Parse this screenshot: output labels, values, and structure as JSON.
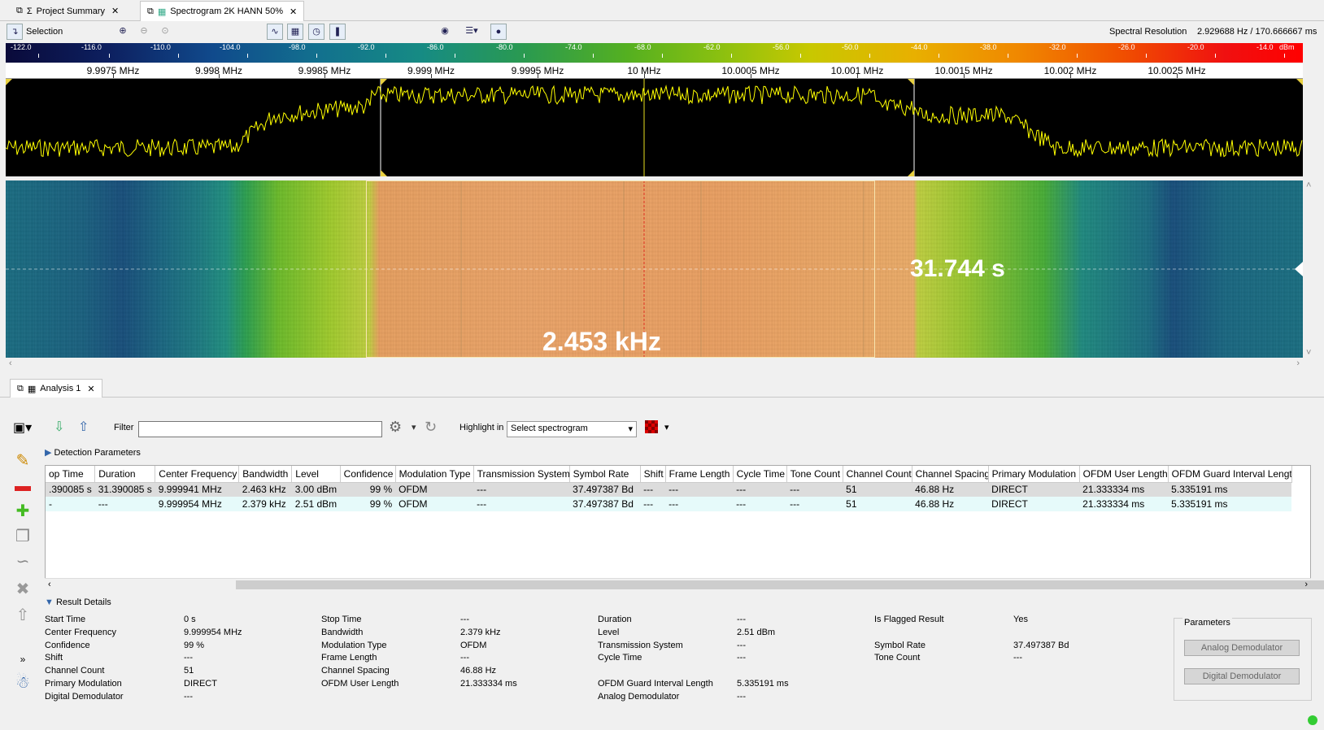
{
  "tabs": [
    {
      "label": "Project Summary",
      "icon": "sigma-icon"
    },
    {
      "label": "Spectrogram 2K HANN 50%",
      "icon": "spectrogram-icon"
    }
  ],
  "toolbar": {
    "selection_label": "Selection",
    "spectral_resolution_label": "Spectral Resolution",
    "spectral_resolution_value": "2.929688 Hz / 170.666667 ms"
  },
  "colorbar": {
    "labels": [
      "-122.0",
      "-116.0",
      "-110.0",
      "-104.0",
      "-98.0",
      "-92.0",
      "-86.0",
      "-80.0",
      "-74.0",
      "-68.0",
      "-62.0",
      "-56.0",
      "-50.0",
      "-44.0",
      "-38.0",
      "-32.0",
      "-26.0",
      "-20.0",
      "-14.0"
    ],
    "unit": "dBm"
  },
  "freq_axis": {
    "labels": [
      "9.9975 MHz",
      "9.998 MHz",
      "9.9985 MHz",
      "9.999 MHz",
      "9.9995 MHz",
      "10 MHz",
      "10.0005 MHz",
      "10.001 MHz",
      "10.0015 MHz",
      "10.002 MHz",
      "10.0025 MHz"
    ]
  },
  "waterfall": {
    "time_label": "31.744 s",
    "bandwidth_label": "2.453 kHz"
  },
  "analysis": {
    "tab_label": "Analysis 1",
    "filter_label": "Filter",
    "filter_value": "",
    "highlight_label": "Highlight in",
    "highlight_select": "Select spectrogram",
    "detection_header": "Detection Parameters",
    "result_header": "Result Details"
  },
  "table": {
    "columns": [
      "op Time",
      "Duration",
      "Center Frequency",
      "Bandwidth",
      "Level",
      "Confidence",
      "Modulation Type",
      "Transmission System",
      "Symbol Rate",
      "Shift",
      "Frame Length",
      "Cycle Time",
      "Tone Count",
      "Channel Count",
      "Channel Spacing",
      "Primary Modulation",
      "OFDM User Length",
      "OFDM Guard Interval Length"
    ],
    "rows": [
      [
        ".390085 s",
        "31.390085 s",
        "9.999941 MHz",
        "2.463 kHz",
        "3.00 dBm",
        "99 %",
        "OFDM",
        "---",
        "37.497387 Bd",
        "---",
        "---",
        "---",
        "---",
        "51",
        "46.88 Hz",
        "DIRECT",
        "21.333334 ms",
        "5.335191 ms"
      ],
      [
        "-",
        "---",
        "9.999954 MHz",
        "2.379 kHz",
        "2.51 dBm",
        "99 %",
        "OFDM",
        "---",
        "37.497387 Bd",
        "---",
        "---",
        "---",
        "---",
        "51",
        "46.88 Hz",
        "DIRECT",
        "21.333334 ms",
        "5.335191 ms"
      ]
    ]
  },
  "details": {
    "col1": [
      [
        "Start Time",
        "0 s"
      ],
      [
        "Center Frequency",
        "9.999954 MHz"
      ],
      [
        "Confidence",
        "99 %"
      ],
      [
        "Shift",
        "---"
      ],
      [
        "Channel Count",
        "51"
      ],
      [
        "Primary Modulation",
        "DIRECT"
      ],
      [
        "Digital Demodulator",
        "---"
      ]
    ],
    "col2": [
      [
        "Stop Time",
        "---"
      ],
      [
        "Bandwidth",
        "2.379 kHz"
      ],
      [
        "Modulation Type",
        "OFDM"
      ],
      [
        "Frame Length",
        "---"
      ],
      [
        "Channel Spacing",
        "46.88 Hz"
      ],
      [
        "OFDM User Length",
        "21.333334 ms"
      ]
    ],
    "col3": [
      [
        "Duration",
        "---"
      ],
      [
        "Level",
        "2.51 dBm"
      ],
      [
        "Transmission System",
        "---"
      ],
      [
        "Cycle Time",
        "---"
      ],
      [
        "",
        ""
      ],
      [
        "OFDM Guard Interval Length",
        "5.335191 ms"
      ],
      [
        "Analog Demodulator",
        "---"
      ]
    ],
    "col4": [
      [
        "Is Flagged Result",
        "Yes"
      ],
      [
        "",
        ""
      ],
      [
        "Symbol Rate",
        "37.497387 Bd"
      ],
      [
        "Tone Count",
        "---"
      ]
    ],
    "parameters_label": "Parameters",
    "analog_btn": "Analog Demodulator",
    "digital_btn": "Digital Demodulator"
  }
}
